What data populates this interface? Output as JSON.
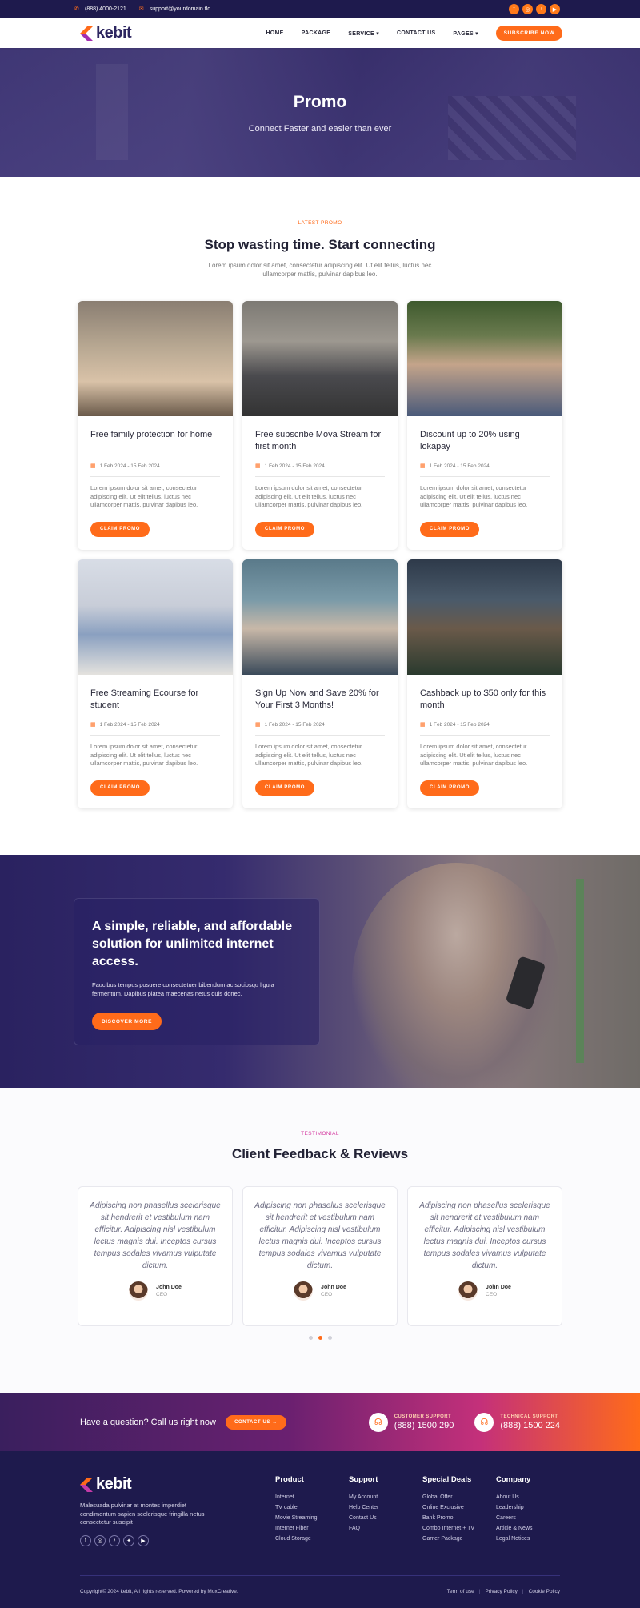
{
  "topbar": {
    "phone": "(888) 4000-2121",
    "email": "support@yourdomain.tld",
    "socials": [
      "facebook-icon",
      "instagram-icon",
      "tiktok-icon",
      "youtube-icon"
    ]
  },
  "nav": {
    "brand": "kebit",
    "items": [
      "HOME",
      "PACKAGE",
      "SERVICE",
      "CONTACT US",
      "PAGES"
    ],
    "cta": "SUBSCRIBE NOW"
  },
  "hero": {
    "title": "Promo",
    "subtitle": "Connect Faster and easier than ever"
  },
  "promos": {
    "eyebrow": "LATEST PROMO",
    "title": "Stop wasting time. Start connecting",
    "desc": "Lorem ipsum dolor sit amet, consectetur adipiscing elit. Ut elit tellus, luctus nec ullamcorper mattis, pulvinar dapibus leo.",
    "cards": [
      {
        "title": "Free family protection for home",
        "date": "1 Feb 2024 - 15 Feb 2024",
        "desc": "Lorem ipsum dolor sit amet, consectetur adipiscing elit. Ut elit tellus, luctus nec ullamcorper mattis, pulvinar dapibus leo.",
        "button": "CLAIM PROMO"
      },
      {
        "title": "Free subscribe Mova Stream for first month",
        "date": "1 Feb 2024 - 15 Feb 2024",
        "desc": "Lorem ipsum dolor sit amet, consectetur adipiscing elit. Ut elit tellus, luctus nec ullamcorper mattis, pulvinar dapibus leo.",
        "button": "CLAIM PROMO"
      },
      {
        "title": "Discount up to 20% using lokapay",
        "date": "1 Feb 2024 - 15 Feb 2024",
        "desc": "Lorem ipsum dolor sit amet, consectetur adipiscing elit. Ut elit tellus, luctus nec ullamcorper mattis, pulvinar dapibus leo.",
        "button": "CLAIM PROMO"
      },
      {
        "title": "Free Streaming Ecourse for student",
        "date": "1 Feb 2024 - 15 Feb 2024",
        "desc": "Lorem ipsum dolor sit amet, consectetur adipiscing elit. Ut elit tellus, luctus nec ullamcorper mattis, pulvinar dapibus leo.",
        "button": "CLAIM PROMO"
      },
      {
        "title": "Sign Up Now and Save 20% for Your First 3 Months!",
        "date": "1 Feb 2024 - 15 Feb 2024",
        "desc": "Lorem ipsum dolor sit amet, consectetur adipiscing elit. Ut elit tellus, luctus nec ullamcorper mattis, pulvinar dapibus leo.",
        "button": "CLAIM PROMO"
      },
      {
        "title": "Cashback up to $50 only for this month",
        "date": "1 Feb 2024 - 15 Feb 2024",
        "desc": "Lorem ipsum dolor sit amet, consectetur adipiscing elit. Ut elit tellus, luctus nec ullamcorper mattis, pulvinar dapibus leo.",
        "button": "CLAIM PROMO"
      }
    ]
  },
  "feature": {
    "title": "A simple, reliable, and affordable solution for unlimited internet access.",
    "desc": "Faucibus tempus posuere consectetuer bibendum ac sociosqu ligula fermentum. Dapibus platea maecenas netus duis donec.",
    "button": "DISCOVER MORE"
  },
  "testimonials": {
    "eyebrow": "TESTIMONIAL",
    "title": "Client Feedback & Reviews",
    "items": [
      {
        "quote": "Adipiscing non phasellus scelerisque sit hendrerit et vestibulum nam efficitur. Adipiscing nisl vestibulum lectus magnis dui. Inceptos cursus tempus sodales vivamus vulputate dictum.",
        "name": "John Doe",
        "role": "CEO"
      },
      {
        "quote": "Adipiscing non phasellus scelerisque sit hendrerit et vestibulum nam efficitur. Adipiscing nisl vestibulum lectus magnis dui. Inceptos cursus tempus sodales vivamus vulputate dictum.",
        "name": "John Doe",
        "role": "CEO"
      },
      {
        "quote": "Adipiscing non phasellus scelerisque sit hendrerit et vestibulum nam efficitur. Adipiscing nisl vestibulum lectus magnis dui. Inceptos cursus tempus sodales vivamus vulputate dictum.",
        "name": "John Doe",
        "role": "CEO"
      }
    ]
  },
  "cta": {
    "question": "Have a question? Call us right now",
    "button": "CONTACT US",
    "customer_label": "CUSTOMER SUPPORT",
    "customer_phone": "(888) 1500 290",
    "technical_label": "TECHNICAL SUPPORT",
    "technical_phone": "(888) 1500 224"
  },
  "footer": {
    "brand": "kebit",
    "desc": "Malesuada pulvinar at montes imperdiet condimentum sapien scelerisque fringilla netus consectetur suscipit",
    "columns": [
      {
        "title": "Product",
        "links": [
          "Internet",
          "TV cable",
          "Movie Streaming",
          "Internet Fiber",
          "Cloud Storage"
        ]
      },
      {
        "title": "Support",
        "links": [
          "My Account",
          "Help Center",
          "Contact Us",
          "FAQ"
        ]
      },
      {
        "title": "Special Deals",
        "links": [
          "Global Offer",
          "Online Exclusive",
          "Bank Promo",
          "Combo Internet + TV",
          "Gamer Package"
        ]
      },
      {
        "title": "Company",
        "links": [
          "About Us",
          "Leadership",
          "Careers",
          "Article & News",
          "Legal Notices"
        ]
      }
    ],
    "copyright": "Copyright© 2024 kebit, All rights reserved. Powered by MoxCreative.",
    "legal": [
      "Term of use",
      "Privacy Policy",
      "Cookie Policy"
    ]
  },
  "colors": {
    "accent": "#ff6b1a",
    "navy": "#1e1a4d",
    "pink": "#d43aa0"
  }
}
